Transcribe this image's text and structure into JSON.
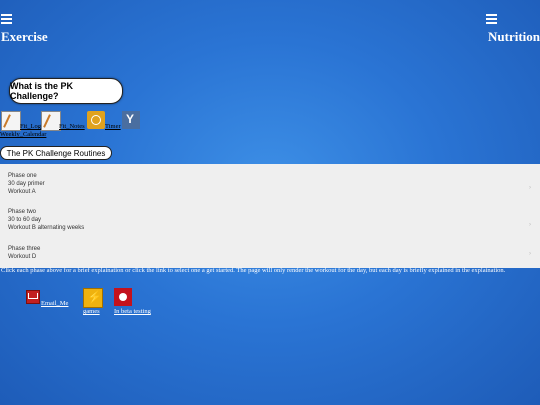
{
  "nav": {
    "left_label": "Exercise",
    "right_label": "Nutrition"
  },
  "pk_button": {
    "label": "What is the PK Challenge?"
  },
  "tools": {
    "log_label": "Fit_Log",
    "notes_label": "Fit_Notes",
    "timer_label": "Timer",
    "calendar_label": "Weekly_Calendar"
  },
  "routines": {
    "title": "The PK Challenge Routines",
    "phases": [
      {
        "name": "Phase one",
        "duration": "30 day primer",
        "workout": "Workout A"
      },
      {
        "name": "Phase two",
        "duration": "30 to 60 day",
        "workout": "Workout B alternating weeks"
      },
      {
        "name": "Phase three",
        "duration": "",
        "workout": "Workout D"
      }
    ],
    "arrow": "›"
  },
  "explanation": "Click each phase above for a brief explaination or click the link to select one a get started. The page will only render the workout for the day, but each day is briefly explained in the explaination.",
  "footer": {
    "email_label": "Email_Me",
    "games_label": "games",
    "beta_label": "In beta testing"
  },
  "colors": {
    "background": "#2a74d4",
    "panel": "#efefef"
  }
}
